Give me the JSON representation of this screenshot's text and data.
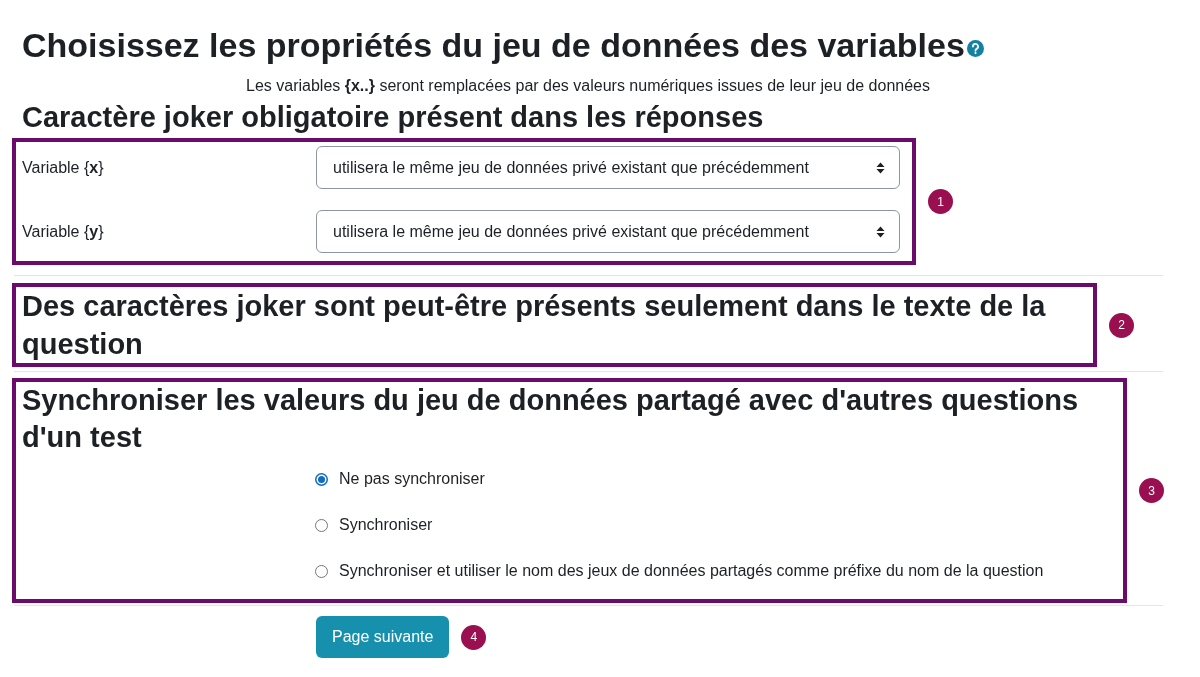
{
  "title": "Choisissez les propriétés du jeu de données des variables",
  "intro": "Les variables **{x..}** seront remplacées par des valeurs numériques issues de leur jeu de données",
  "mandatory_wildcards": {
    "heading": "Caractère joker obligatoire présent dans les réponses",
    "callout": "1",
    "variables": [
      {
        "label": "Variable {**x**}",
        "value": "utilisera le même jeu de données privé existant que précédemment"
      },
      {
        "label": "Variable {**y**}",
        "value": "utilisera le même jeu de données privé existant que précédemment"
      }
    ]
  },
  "optional_wildcards": {
    "heading": "Des caractères joker sont peut-être présents seulement dans le texte de la question",
    "callout": "2"
  },
  "synchronize": {
    "heading": "Synchroniser les valeurs du jeu de données partagé avec d'autres questions d'un test",
    "callout": "3",
    "options": [
      {
        "label": "Ne pas synchroniser",
        "selected": true
      },
      {
        "label": "Synchroniser",
        "selected": false
      },
      {
        "label": "Synchroniser et utiliser le nom des jeux de données partagés comme préfixe du nom de la question",
        "selected": false
      }
    ]
  },
  "next_button": {
    "label": "Page suivante",
    "callout": "4"
  }
}
